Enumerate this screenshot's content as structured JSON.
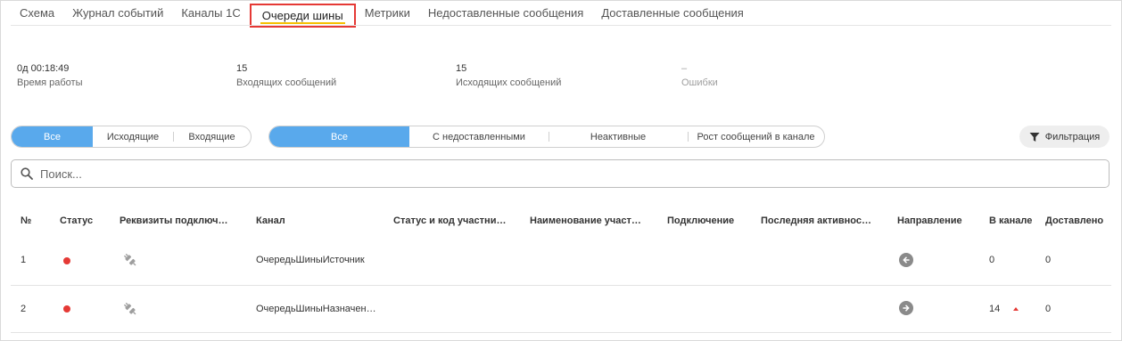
{
  "tabs": [
    {
      "label": "Схема"
    },
    {
      "label": "Журнал событий"
    },
    {
      "label": "Каналы 1С"
    },
    {
      "label": "Очереди шины",
      "active": true
    },
    {
      "label": "Метрики"
    },
    {
      "label": "Недоставленные сообщения"
    },
    {
      "label": "Доставленные сообщения"
    }
  ],
  "stats": {
    "uptime": {
      "value": "0д 00:18:49",
      "label": "Время работы"
    },
    "incoming": {
      "value": "15",
      "label": "Входящих сообщений"
    },
    "outgoing": {
      "value": "15",
      "label": "Исходящих сообщений"
    },
    "errors": {
      "value": "–",
      "label": "Ошибки"
    }
  },
  "direction_filter": {
    "options": [
      "Все",
      "Исходящие",
      "Входящие"
    ],
    "selected": "Все"
  },
  "state_filter": {
    "options": [
      "Все",
      "С недоставленными",
      "Неактивные",
      "Рост сообщений в канале"
    ],
    "selected": "Все"
  },
  "filter_button": {
    "label": "Фильтрация"
  },
  "search": {
    "placeholder": "Поиск...",
    "value": ""
  },
  "table": {
    "columns": [
      "№",
      "Статус",
      "Реквизиты подключ…",
      "Канал",
      "Статус и код участни…",
      "Наименование участ…",
      "Подключение",
      "Последняя активнос…",
      "Направление",
      "В канале",
      "Доставлено"
    ],
    "rows": [
      {
        "num": "1",
        "status": "error",
        "channel": "ОчередьШиныИсточник",
        "direction": "incoming",
        "in_channel": "0",
        "delivered": "0",
        "growth": false
      },
      {
        "num": "2",
        "status": "error",
        "channel": "ОчередьШиныНазначен…",
        "direction": "outgoing",
        "in_channel": "14",
        "delivered": "0",
        "growth": true
      }
    ]
  },
  "colors": {
    "accent": "#59a9ec",
    "active_tab_border": "#e53935",
    "active_tab_underline": "#f5c000",
    "status_error": "#e53935"
  }
}
